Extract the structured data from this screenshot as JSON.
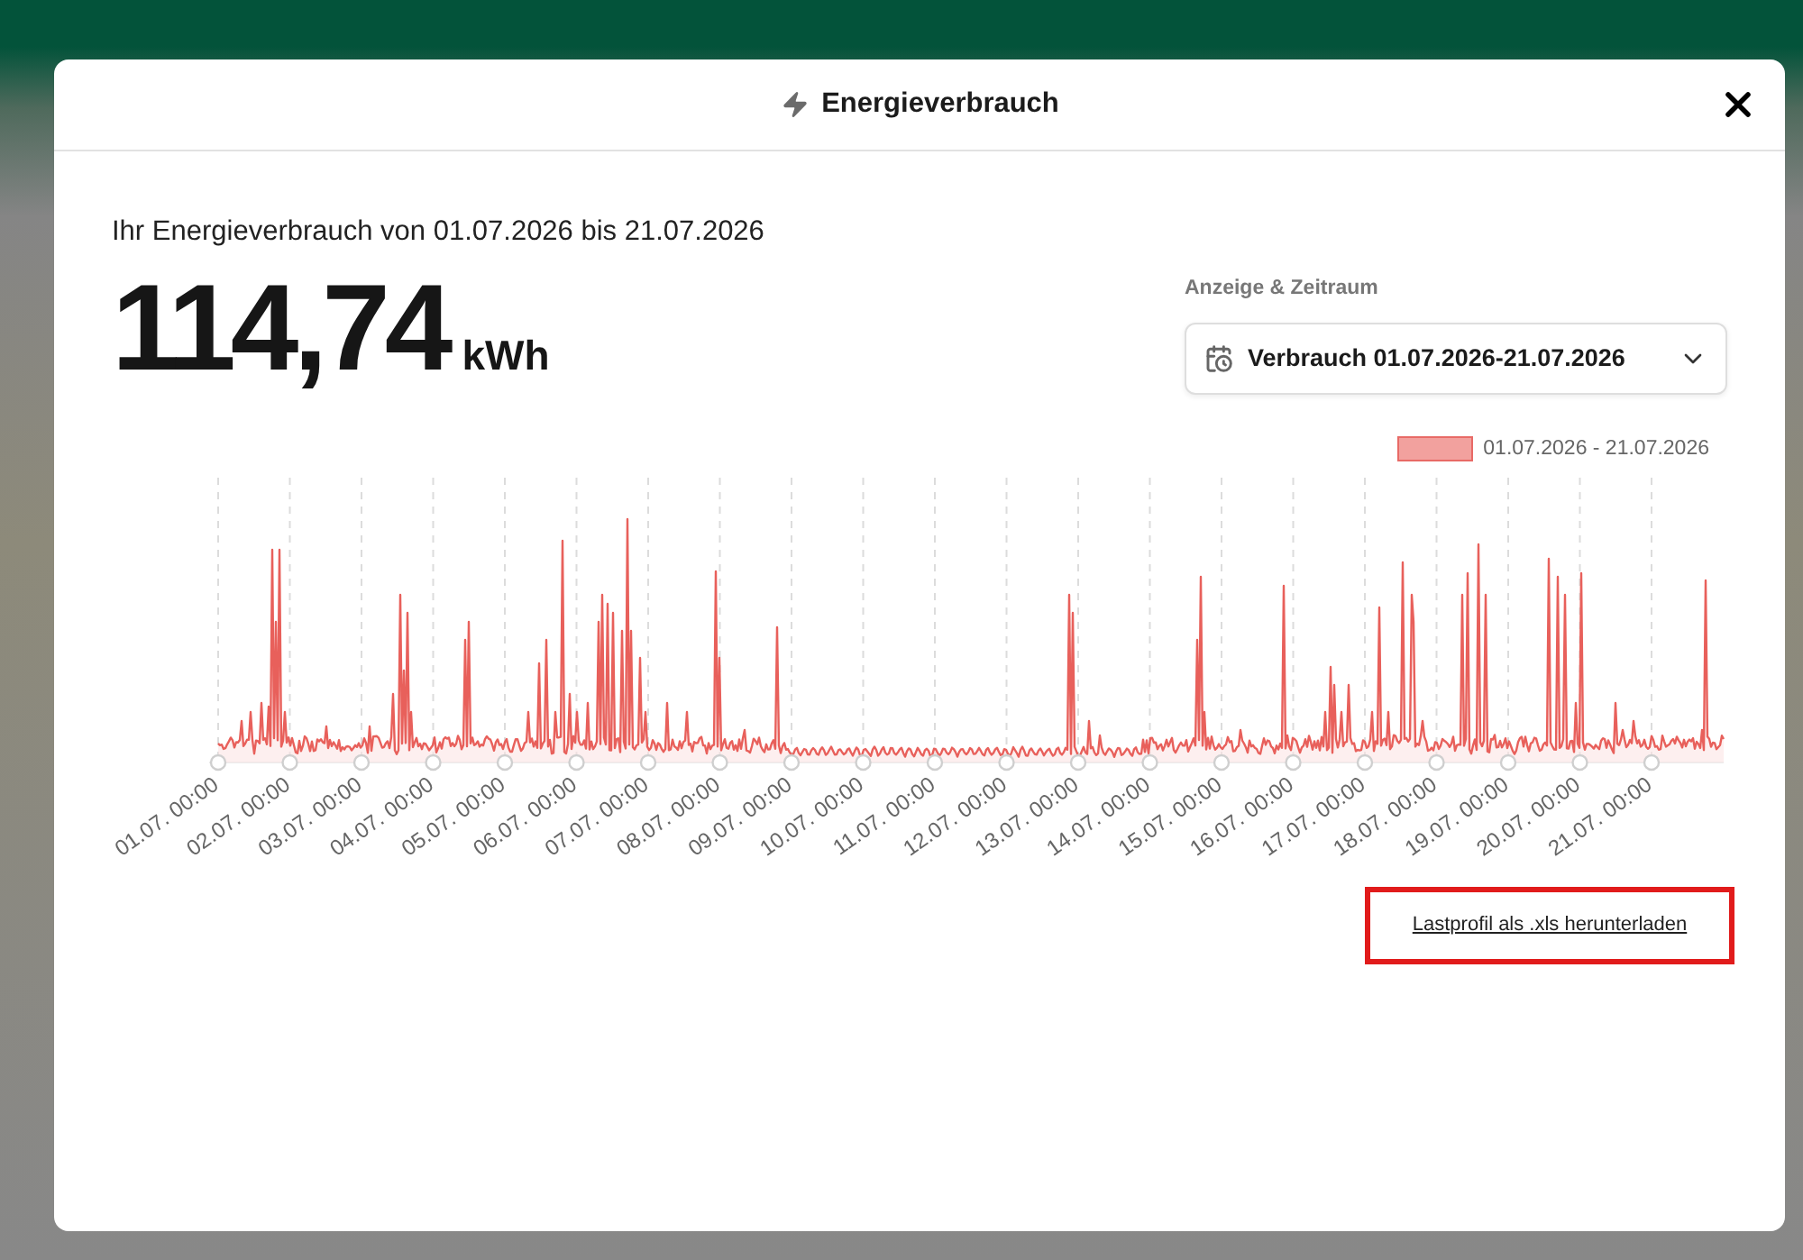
{
  "dialog": {
    "title": "Energieverbrauch"
  },
  "summary": {
    "caption": "Ihr Energieverbrauch von 01.07.2026 bis 21.07.2026",
    "value": "114,74",
    "unit": "kWh"
  },
  "period_select": {
    "label": "Anzeige & Zeitraum",
    "value": "Verbrauch 01.07.2026-21.07.2026"
  },
  "chart": {
    "legend": [
      "01.07.2026 - 21.07.2026"
    ],
    "x_labels": [
      "01.07. 00:00",
      "02.07. 00:00",
      "03.07. 00:00",
      "04.07. 00:00",
      "05.07. 00:00",
      "06.07. 00:00",
      "07.07. 00:00",
      "08.07. 00:00",
      "09.07. 00:00",
      "10.07. 00:00",
      "11.07. 00:00",
      "12.07. 00:00",
      "13.07. 00:00",
      "14.07. 00:00",
      "15.07. 00:00",
      "16.07. 00:00",
      "17.07. 00:00",
      "18.07. 00:00",
      "19.07. 00:00",
      "20.07. 00:00",
      "21.07. 00:00"
    ]
  },
  "download_link": "Lastprofil als .xls herunterladen"
}
